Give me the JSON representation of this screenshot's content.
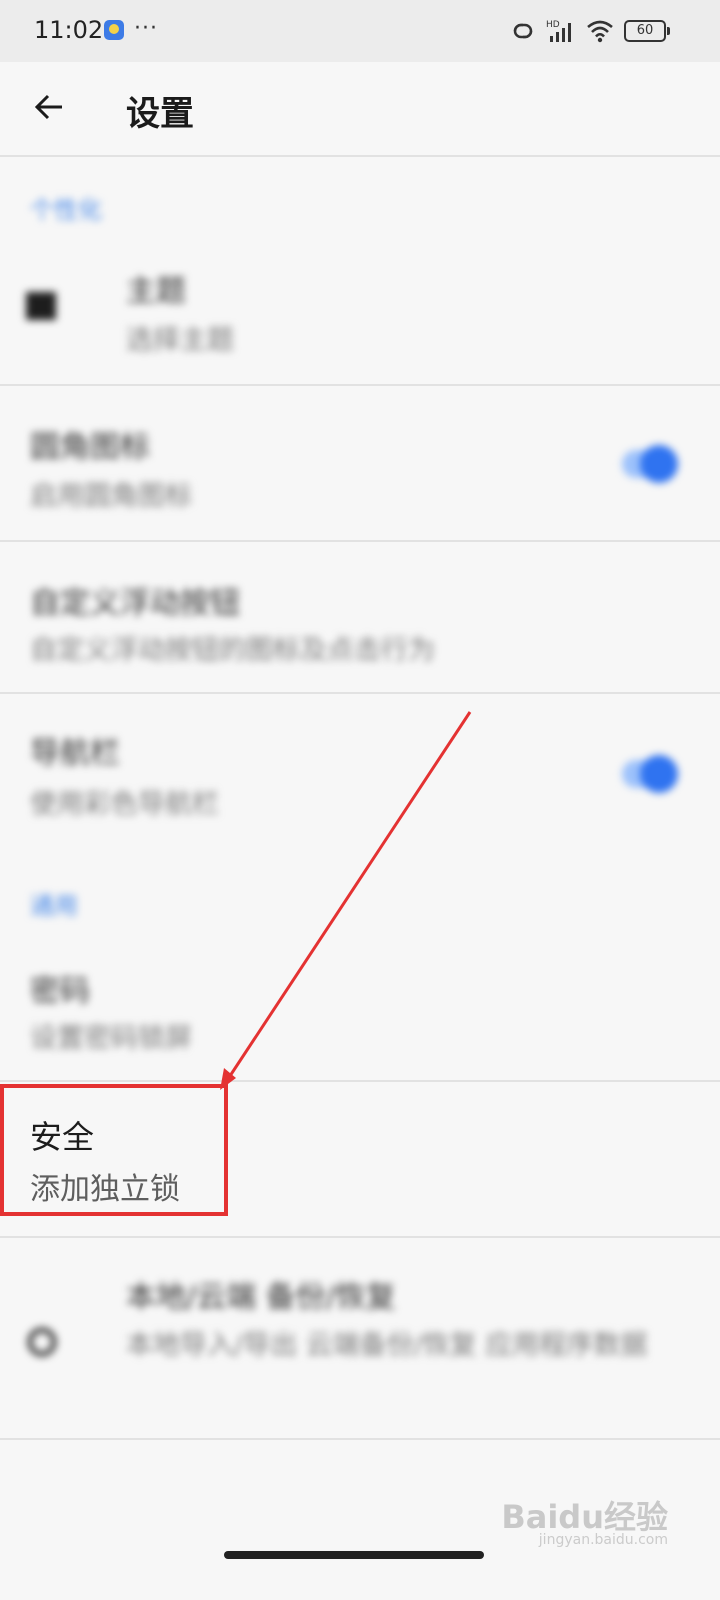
{
  "status_bar": {
    "time": "11:02",
    "dots": "···",
    "battery": "60",
    "icons": [
      "link-icon",
      "signal-hd-icon",
      "wifi-icon",
      "battery-icon"
    ]
  },
  "app_bar": {
    "title": "设置",
    "back_icon": "arrow-left-icon"
  },
  "sections": {
    "personalization_header": "个性化",
    "theme": {
      "title": "主题",
      "summary": "选择主题"
    },
    "item2": {
      "title": "圆角图标",
      "summary": "启用圆角图标",
      "toggle_on": true
    },
    "item3": {
      "title": "自定义浮动按钮",
      "summary": "自定义浮动按钮的图标及点击行为"
    },
    "item4": {
      "title": "导航栏",
      "summary": "使用彩色导航栏",
      "toggle_on": true
    },
    "general_header": "通用",
    "password": {
      "title": "密码",
      "summary": "设置密码锁屏"
    },
    "security": {
      "title": "安全",
      "summary": "添加独立锁"
    },
    "backup": {
      "title": "本地/云端 备份/恢复",
      "summary": "本地导入/导出 云端备份/恢复 应用程序数据"
    }
  },
  "annotation": {
    "highlight_color": "#e43232",
    "arrow_color": "#e43232"
  },
  "watermark": {
    "text": "Baidu经验",
    "sub": "jingyan.baidu.com"
  },
  "colors": {
    "accent": "#2f73f0",
    "background": "#f7f7f7"
  }
}
